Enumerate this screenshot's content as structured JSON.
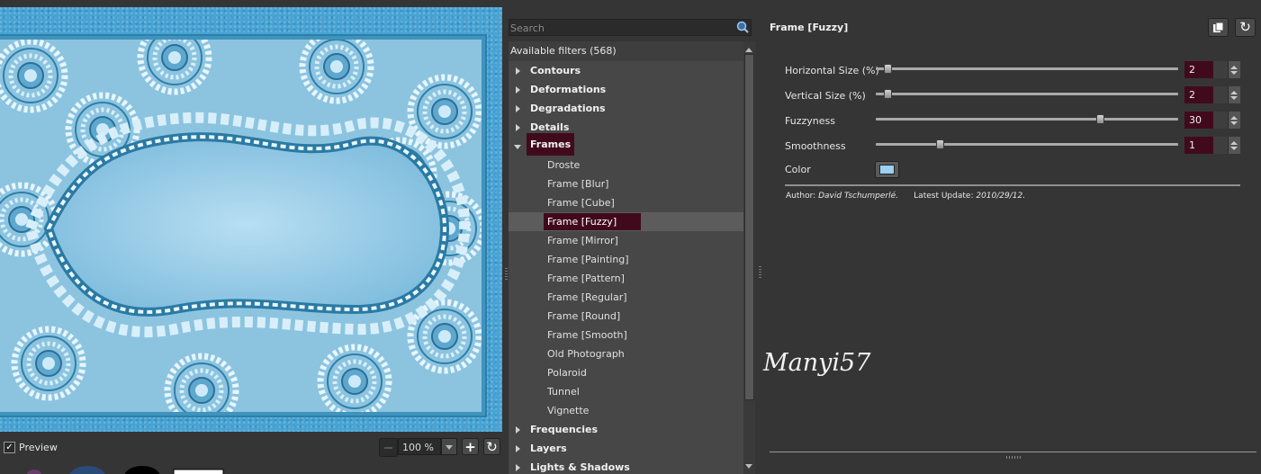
{
  "preview": {
    "checkbox_checked": true,
    "label": "Preview",
    "zoom_value": "100 %"
  },
  "filters": {
    "search_placeholder": "Search",
    "header": "Available filters (568)",
    "categories_before": [
      "Contours",
      "Deformations",
      "Degradations",
      "Details"
    ],
    "open_category": "Frames",
    "items": [
      "Droste",
      "Frame [Blur]",
      "Frame [Cube]",
      "Frame [Fuzzy]",
      "Frame [Mirror]",
      "Frame [Painting]",
      "Frame [Pattern]",
      "Frame [Regular]",
      "Frame [Round]",
      "Frame [Smooth]",
      "Old Photograph",
      "Polaroid",
      "Tunnel",
      "Vignette"
    ],
    "selected_item": "Frame [Fuzzy]",
    "categories_after": [
      "Frequencies",
      "Layers",
      "Lights & Shadows"
    ]
  },
  "params": {
    "title": "Frame [Fuzzy]",
    "sliders": [
      {
        "label": "Horizontal Size (%)",
        "value": "2",
        "fraction": 0.04
      },
      {
        "label": "Vertical Size (%)",
        "value": "2",
        "fraction": 0.04
      },
      {
        "label": "Fuzzyness",
        "value": "30",
        "fraction": 0.74
      },
      {
        "label": "Smoothness",
        "value": "1",
        "fraction": 0.21
      }
    ],
    "color_label": "Color",
    "color_value": "#9cd0f4",
    "author_label": "Author:",
    "author_name": "David Tschumperlé.",
    "update_label": "Latest Update:",
    "update_value": "2010/29/12."
  },
  "watermark": "Manyi57",
  "colors": {
    "selection": "#410a1c",
    "panel_bg": "#353535",
    "tree_bg": "#474747",
    "preview_blue": "#46a3d4"
  }
}
